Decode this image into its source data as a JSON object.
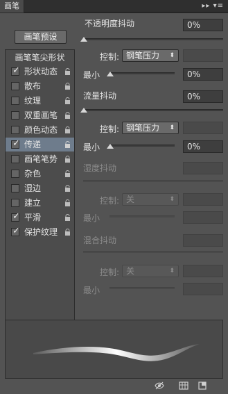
{
  "titlebar": {
    "tab": "画笔",
    "menu_glyph": "▸▸ ▾≡"
  },
  "preset_button": "画笔预设",
  "left_list": {
    "header": "画笔笔尖形状",
    "items": [
      {
        "label": "形状动态",
        "checked": true,
        "selected": false
      },
      {
        "label": "散布",
        "checked": false,
        "selected": false
      },
      {
        "label": "纹理",
        "checked": false,
        "selected": false
      },
      {
        "label": "双重画笔",
        "checked": false,
        "selected": false
      },
      {
        "label": "颜色动态",
        "checked": false,
        "selected": false
      },
      {
        "label": "传递",
        "checked": true,
        "selected": true
      },
      {
        "label": "画笔笔势",
        "checked": false,
        "selected": false
      },
      {
        "label": "杂色",
        "checked": false,
        "selected": false
      },
      {
        "label": "湿边",
        "checked": false,
        "selected": false
      },
      {
        "label": "建立",
        "checked": false,
        "selected": false
      },
      {
        "label": "平滑",
        "checked": true,
        "selected": false
      },
      {
        "label": "保护纹理",
        "checked": true,
        "selected": false
      }
    ]
  },
  "settings": {
    "opacity_jitter": {
      "label": "不透明度抖动",
      "value": "0%",
      "control_label": "控制:",
      "control_value": "钢笔压力",
      "min_label": "最小",
      "min_value": "0%"
    },
    "flow_jitter": {
      "label": "流量抖动",
      "value": "0%",
      "control_label": "控制:",
      "control_value": "钢笔压力",
      "min_label": "最小",
      "min_value": "0%"
    },
    "wetness_jitter": {
      "label": "湿度抖动",
      "control_label": "控制:",
      "control_value": "关",
      "min_label": "最小"
    },
    "mix_jitter": {
      "label": "混合抖动",
      "control_label": "控制:",
      "control_value": "关",
      "min_label": "最小"
    }
  },
  "icons": {
    "checkbox_tick": "✓",
    "select_arrow": "⬍",
    "lock": "lock-icon",
    "footer": [
      "eye-toggle-icon",
      "grid-icon",
      "new-brush-icon"
    ]
  }
}
